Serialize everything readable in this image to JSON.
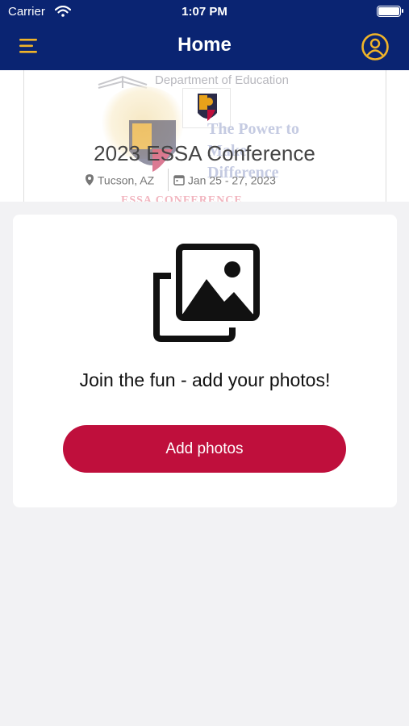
{
  "status_bar": {
    "carrier": "Carrier",
    "time": "1:07 PM"
  },
  "nav": {
    "title": "Home",
    "menu_icon": "hamburger-menu-icon",
    "profile_icon": "user-circle-icon"
  },
  "banner": {
    "department": "Department of Education",
    "tagline": [
      "The Power to",
      "Make",
      "Difference"
    ],
    "watermark": "ESSA CONFERENCE"
  },
  "event": {
    "title": "2023 ESSA Conference",
    "location": "Tucson, AZ",
    "dates": "Jan 25 - 27, 2023"
  },
  "photos_card": {
    "icon": "photo-gallery-icon",
    "message": "Join the fun - add your photos!",
    "button_label": "Add photos"
  },
  "colors": {
    "nav_background": "#0a2472",
    "nav_icon_accent": "#f0b429",
    "button_background": "#bf0f3c",
    "page_background": "#f2f2f4"
  }
}
